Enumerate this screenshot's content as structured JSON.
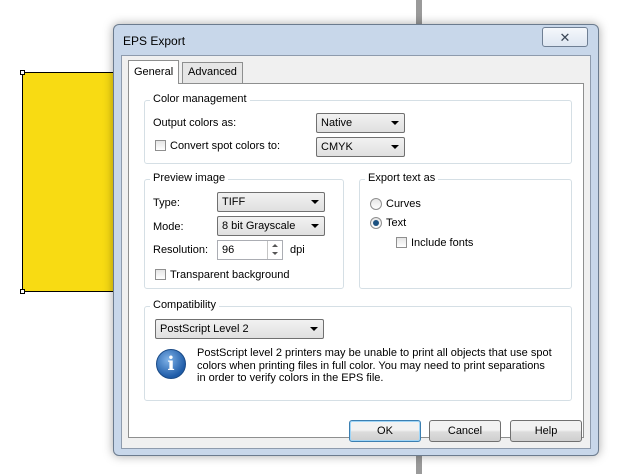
{
  "dialog": {
    "title": "EPS Export",
    "close_icon": "close-icon",
    "tabs": [
      {
        "label": "General",
        "active": true
      },
      {
        "label": "Advanced",
        "active": false
      }
    ]
  },
  "color_management": {
    "legend": "Color management",
    "output_colors_label": "Output colors as:",
    "output_colors_value": "Native",
    "convert_spot_label": "Convert spot colors to:",
    "convert_spot_checked": false,
    "convert_spot_value": "CMYK"
  },
  "preview_image": {
    "legend": "Preview image",
    "type_label": "Type:",
    "type_value": "TIFF",
    "mode_label": "Mode:",
    "mode_value": "8 bit Grayscale",
    "resolution_label": "Resolution:",
    "resolution_value": "96",
    "resolution_unit": "dpi",
    "transparent_label": "Transparent background",
    "transparent_checked": false
  },
  "export_text": {
    "legend": "Export text as",
    "options": [
      {
        "label": "Curves",
        "selected": false
      },
      {
        "label": "Text",
        "selected": true
      }
    ],
    "include_fonts_label": "Include fonts",
    "include_fonts_checked": false
  },
  "compatibility": {
    "legend": "Compatibility",
    "value": "PostScript Level 2",
    "info_icon": "info-icon",
    "info_lines": [
      "PostScript level 2 printers may be unable to print all objects that use spot",
      "colors when printing files in full color. You may need to print separations",
      "in order to verify colors in the EPS file."
    ]
  },
  "buttons": {
    "ok": "OK",
    "cancel": "Cancel",
    "help": "Help"
  },
  "colors": {
    "canvas_object": "#f8db13",
    "dialog_frame": "#c8d7ea",
    "info_icon": "#1f5ca8"
  }
}
